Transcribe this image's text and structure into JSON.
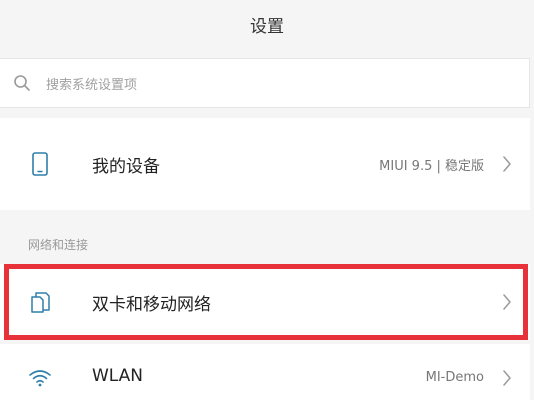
{
  "header": {
    "title": "设置"
  },
  "search": {
    "placeholder": "搜索系统设置项",
    "icon": "search-icon"
  },
  "device_row": {
    "label": "我的设备",
    "value": "MIUI 9.5 | 稳定版",
    "icon": "phone-icon"
  },
  "network_section": {
    "header": "网络和连接",
    "items": [
      {
        "label": "双卡和移动网络",
        "value": "",
        "icon": "sim-cards-icon",
        "highlighted": true
      },
      {
        "label": "WLAN",
        "value": "MI-Demo",
        "icon": "wifi-icon"
      }
    ]
  },
  "colors": {
    "accent": "#2f7fa8",
    "highlight": "#e8323a",
    "background": "#f5f5f5"
  }
}
